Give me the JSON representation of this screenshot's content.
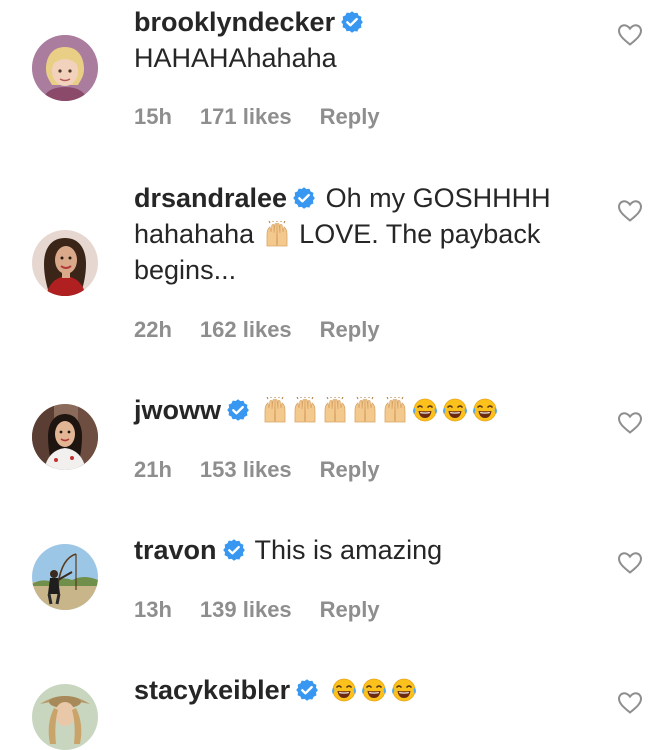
{
  "comments": [
    {
      "username": "brooklyndecker",
      "verified": true,
      "text": "HAHAHAhahaha",
      "time": "15h",
      "likes": "171 likes",
      "reply": "Reply"
    },
    {
      "username": "drsandralee",
      "verified": true,
      "text_part1": "Oh my GOSHHHH hahahaha",
      "text_part2": "LOVE. The payback begins...",
      "emoji": [
        "raising-hands"
      ],
      "time": "22h",
      "likes": "162 likes",
      "reply": "Reply"
    },
    {
      "username": "jwoww",
      "verified": true,
      "emoji": [
        "raising-hands",
        "raising-hands",
        "raising-hands",
        "raising-hands",
        "raising-hands",
        "tears-of-joy",
        "tears-of-joy",
        "tears-of-joy"
      ],
      "time": "21h",
      "likes": "153 likes",
      "reply": "Reply"
    },
    {
      "username": "travon",
      "verified": true,
      "text": "This is amazing",
      "time": "13h",
      "likes": "139 likes",
      "reply": "Reply"
    },
    {
      "username": "stacykeibler",
      "verified": true,
      "emoji": [
        "tears-of-joy",
        "tears-of-joy",
        "tears-of-joy"
      ]
    }
  ],
  "colors": {
    "text": "#262626",
    "meta": "#8e8e8e",
    "verified_badge": "#3897f0",
    "heart_outline": "#8e8e8e"
  },
  "icons": {
    "like": "heart-outline-icon",
    "verified": "verified-badge-icon"
  }
}
